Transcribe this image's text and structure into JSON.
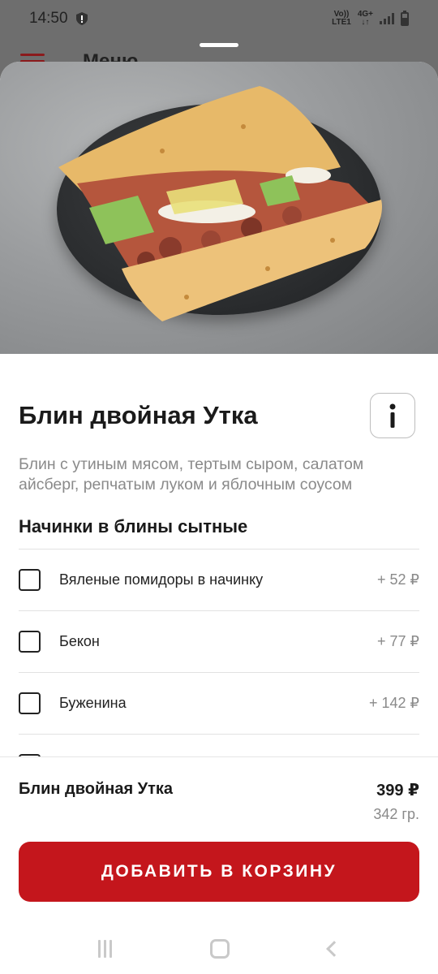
{
  "status_bar": {
    "time": "14:50",
    "volte": "Vo))",
    "lte": "LTE1",
    "network": "4G+",
    "arrows": "↓↑"
  },
  "behind": {
    "title": "Меню"
  },
  "product": {
    "title": "Блин двойная Утка",
    "description": "Блин с утиным мясом, тертым сыром, салатом айсберг, репчатым луком и яблочным соусом",
    "info_icon": "i"
  },
  "section": {
    "title": "Начинки в блины сытные"
  },
  "options": [
    {
      "label": "Вяленые помидоры в начинку",
      "price": "+ 52 ₽",
      "checked": false
    },
    {
      "label": "Бекон",
      "price": "+ 77 ₽",
      "checked": false
    },
    {
      "label": "Буженина",
      "price": "+ 142 ₽",
      "checked": false
    },
    {
      "label": "",
      "price": "",
      "checked": false
    }
  ],
  "footer": {
    "name": "Блин двойная Утка",
    "price": "399 ₽",
    "weight": "342 гр.",
    "add_button": "ДОБАВИТЬ В КОРЗИНУ"
  },
  "colors": {
    "accent": "#c4161c",
    "text": "#1a1a1a",
    "muted": "#8a8a8a"
  }
}
